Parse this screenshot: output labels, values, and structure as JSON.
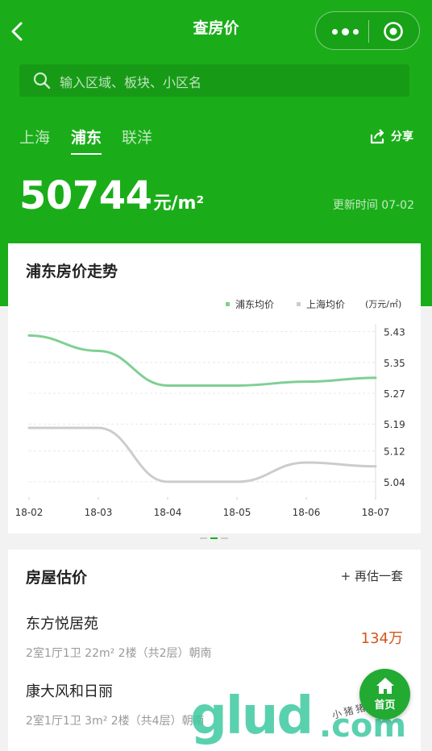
{
  "nav": {
    "title": "查房价",
    "back_icon": "back-arrow-icon",
    "more_icon": "more-dots-icon",
    "close_icon": "miniprogram-close-icon"
  },
  "search": {
    "placeholder": "输入区域、板块、小区名",
    "icon": "search-icon"
  },
  "tabs": [
    {
      "label": "上海",
      "active": false
    },
    {
      "label": "浦东",
      "active": true
    },
    {
      "label": "联洋",
      "active": false
    }
  ],
  "share": {
    "label": "分享",
    "icon": "share-icon"
  },
  "price": {
    "value": "50744",
    "unit": "元/m²"
  },
  "update": "更新时间 07-02",
  "chart_card": {
    "title": "浦东房价走势"
  },
  "chart_data": {
    "type": "line",
    "categories": [
      "18-02",
      "18-03",
      "18-04",
      "18-05",
      "18-06",
      "18-07"
    ],
    "series": [
      {
        "name": "浦东均价",
        "color": "#7fcf94",
        "values": [
          5.42,
          5.38,
          5.29,
          5.29,
          5.3,
          5.31
        ]
      },
      {
        "name": "上海均价",
        "color": "#cccccc",
        "values": [
          5.18,
          5.18,
          5.04,
          5.04,
          5.09,
          5.08
        ]
      }
    ],
    "y_ticks": [
      "5.43",
      "5.35",
      "5.27",
      "5.19",
      "5.12",
      "5.04"
    ],
    "ylabel": "(万元/㎡)",
    "ylim": [
      5.0,
      5.45
    ],
    "y_axis_side": "right",
    "grid": true,
    "legend_position": "top-right"
  },
  "estimate": {
    "title": "房屋估价",
    "add_label": "+ 再估一套",
    "houses": [
      {
        "name": "东方悦居苑",
        "detail": "2室1厅1卫 22m² 2楼（共2层）朝南",
        "price": "134万"
      },
      {
        "name": "康大风和日丽",
        "detail": "2室1厅1卫 3m² 2楼（共4层）朝南",
        "price": ""
      }
    ]
  },
  "home_button": {
    "label": "首页",
    "icon": "home-icon"
  },
  "watermark": {
    "text": "glud",
    "suffix": ".com",
    "handwriting": "小猪猪笔记"
  },
  "colors": {
    "brand_green": "#1aad19",
    "price_orange": "#d4561a"
  }
}
